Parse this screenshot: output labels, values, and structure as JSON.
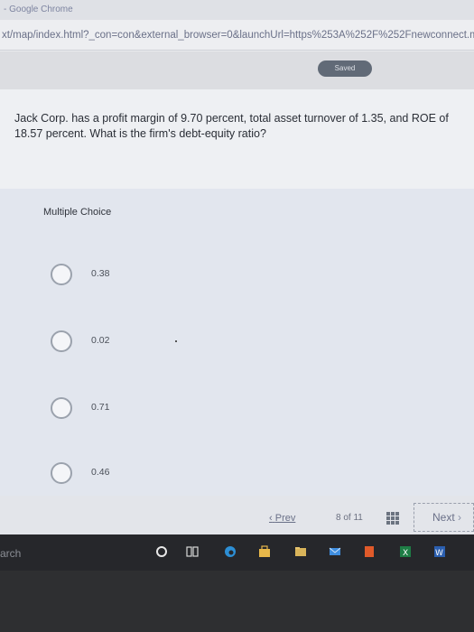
{
  "window": {
    "title": "- Google Chrome",
    "url": "xt/map/index.html?_con=con&external_browser=0&launchUrl=https%253A%252F%252Fnewconnect.mhed"
  },
  "header": {
    "saved_label": "Saved"
  },
  "question": {
    "text": "Jack Corp. has a profit margin of 9.70 percent, total asset turnover of 1.35, and ROE of 18.57 percent. What is the firm's debt-equity ratio?"
  },
  "choices": {
    "section_label": "Multiple Choice",
    "items": [
      {
        "label": "0.38"
      },
      {
        "label": "0.02"
      },
      {
        "label": "0.71"
      },
      {
        "label": "0.46"
      }
    ]
  },
  "navigation": {
    "prev_label": "Prev",
    "page_current": "8",
    "page_of": "of",
    "page_total": "11",
    "next_label": "Next"
  },
  "taskbar": {
    "search_label": "arch",
    "icons": [
      "cortana-icon",
      "task-view-icon",
      "edge-icon",
      "store-icon",
      "folder-icon",
      "mail-icon",
      "office-icon",
      "excel-icon",
      "word-icon"
    ]
  },
  "colors": {
    "background": "#e9eaee",
    "choices_panel": "#e2e6ee",
    "saved_badge": "#616a77",
    "taskbar": "#26272b"
  }
}
